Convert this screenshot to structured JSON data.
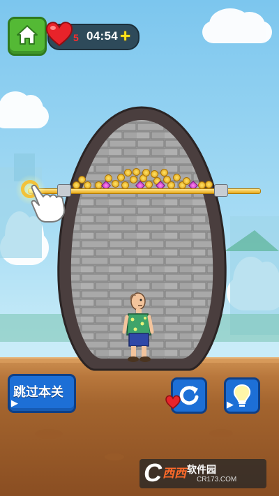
{
  "hud": {
    "lives": "5",
    "timer": "04:54",
    "add_time_symbol": "+"
  },
  "icons": {
    "home": "home-icon",
    "heart": "heart-icon",
    "restart": "restart-icon",
    "hint": "lightbulb-icon",
    "play": "play-icon"
  },
  "buttons": {
    "skip_level_label": "跳过本关"
  },
  "watermark": {
    "brand": "西西",
    "title": "软件园",
    "url": "CR173.COM"
  },
  "colors": {
    "sky": "#7cc6ee",
    "button_green": "#54b935",
    "button_blue": "#1d6fd6",
    "heart_red": "#e8232a",
    "pin_gold": "#f2c23a"
  }
}
